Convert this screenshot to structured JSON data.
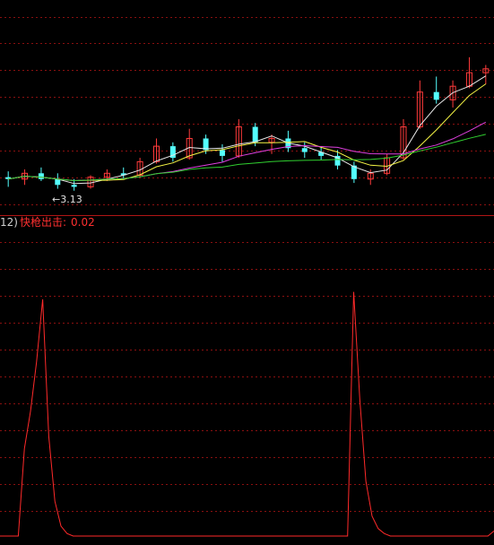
{
  "colors": {
    "background": "#000000",
    "grid": "#8a1010",
    "divider": "#b01515",
    "up_candle": "#ff3b3b",
    "down_candle": "#54ffff",
    "ma1": "#e8e8e8",
    "ma2": "#f5f545",
    "ma3": "#e040e0",
    "ma4": "#30d030",
    "indicator": "#ff2a2a"
  },
  "indicator": {
    "params": "12)",
    "name": "快枪出击:",
    "value": "0.02"
  },
  "annotation": {
    "low_label": "←3.13"
  },
  "chart_data": [
    {
      "type": "candlestick",
      "title": "",
      "lowest_marked": 3.13,
      "series": [
        {
          "values": [
            [
              3.2,
              3.23,
              3.15,
              3.19
            ],
            [
              3.19,
              3.24,
              3.16,
              3.22
            ],
            [
              3.22,
              3.25,
              3.18,
              3.19
            ],
            [
              3.19,
              3.22,
              3.14,
              3.16
            ],
            [
              3.16,
              3.19,
              3.13,
              3.15
            ],
            [
              3.15,
              3.21,
              3.14,
              3.2
            ],
            [
              3.2,
              3.24,
              3.18,
              3.22
            ],
            [
              3.22,
              3.25,
              3.19,
              3.21
            ],
            [
              3.21,
              3.3,
              3.2,
              3.28
            ],
            [
              3.28,
              3.4,
              3.27,
              3.36
            ],
            [
              3.36,
              3.38,
              3.28,
              3.3
            ],
            [
              3.3,
              3.45,
              3.29,
              3.4
            ],
            [
              3.4,
              3.42,
              3.32,
              3.34
            ],
            [
              3.34,
              3.37,
              3.28,
              3.31
            ],
            [
              3.31,
              3.5,
              3.3,
              3.46
            ],
            [
              3.46,
              3.48,
              3.36,
              3.38
            ],
            [
              3.38,
              3.42,
              3.32,
              3.4
            ],
            [
              3.4,
              3.44,
              3.33,
              3.35
            ],
            [
              3.35,
              3.38,
              3.3,
              3.33
            ],
            [
              3.33,
              3.36,
              3.29,
              3.31
            ],
            [
              3.31,
              3.34,
              3.24,
              3.26
            ],
            [
              3.26,
              3.28,
              3.17,
              3.19
            ],
            [
              3.19,
              3.24,
              3.16,
              3.22
            ],
            [
              3.22,
              3.32,
              3.21,
              3.3
            ],
            [
              3.3,
              3.5,
              3.29,
              3.46
            ],
            [
              3.46,
              3.7,
              3.45,
              3.64
            ],
            [
              3.64,
              3.72,
              3.58,
              3.6
            ],
            [
              3.6,
              3.7,
              3.56,
              3.67
            ],
            [
              3.67,
              3.82,
              3.66,
              3.74
            ],
            [
              3.74,
              3.78,
              3.68,
              3.76
            ]
          ]
        }
      ]
    },
    {
      "type": "line",
      "title": "",
      "ylim": [
        0,
        1
      ],
      "series": [
        {
          "values": [
            0.0,
            0.0,
            0.0,
            0.0,
            0.35,
            0.5,
            0.7,
            0.95,
            0.4,
            0.14,
            0.04,
            0.01,
            0.0,
            0.0,
            0.0,
            0.0,
            0.0,
            0.0,
            0.0,
            0.0,
            0.0,
            0.0,
            0.0,
            0.0,
            0.0,
            0.0,
            0.0,
            0.0,
            0.0,
            0.0,
            0.0,
            0.0,
            0.0,
            0.0,
            0.0,
            0.0,
            0.0,
            0.0,
            0.0,
            0.0,
            0.0,
            0.0,
            0.0,
            0.0,
            0.0,
            0.0,
            0.0,
            0.0,
            0.0,
            0.0,
            0.0,
            0.0,
            0.0,
            0.0,
            0.0,
            0.0,
            0.0,
            0.0,
            0.98,
            0.55,
            0.22,
            0.08,
            0.03,
            0.01,
            0.0,
            0.0,
            0.0,
            0.0,
            0.0,
            0.0,
            0.0,
            0.0,
            0.0,
            0.0,
            0.0,
            0.0,
            0.0,
            0.0,
            0.0,
            0.0,
            0.0,
            0.02
          ]
        }
      ]
    }
  ]
}
